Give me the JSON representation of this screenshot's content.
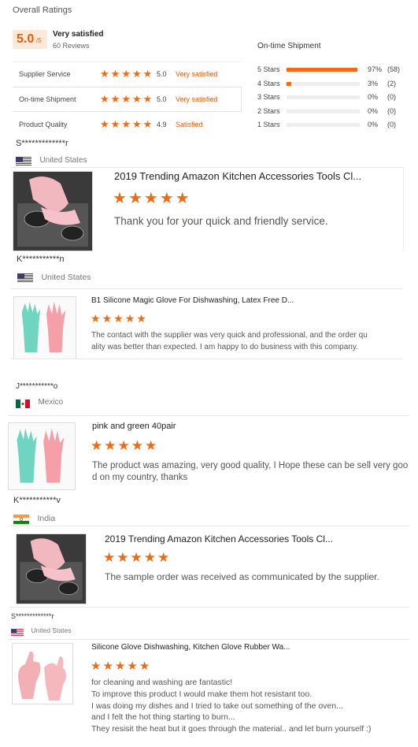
{
  "overall": {
    "heading": "Overall Ratings",
    "score": "5.0",
    "score_suffix": "/5",
    "label": "Very satisfied",
    "reviews": "60 Reviews"
  },
  "metrics": [
    {
      "label": "Supplier Service",
      "score": "5.0",
      "text": "Very satisfied",
      "stars": 5
    },
    {
      "label": "On-time Shipment",
      "score": "5.0",
      "text": "Very satisfied",
      "stars": 5
    },
    {
      "label": "Product Quality",
      "score": "4.9",
      "text": "Satisfied",
      "stars": 5
    }
  ],
  "shipment": {
    "title": "On-time Shipment",
    "rows": [
      {
        "label": "5 Stars",
        "percent": "97%",
        "count": "(58)",
        "fraction": 0.97
      },
      {
        "label": "4 Stars",
        "percent": "3%",
        "count": "(2)",
        "fraction": 0.06
      },
      {
        "label": "3 Stars",
        "percent": "0%",
        "count": "(0)",
        "fraction": 0
      },
      {
        "label": "2 Stars",
        "percent": "0%",
        "count": "(0)",
        "fraction": 0
      },
      {
        "label": "1 Stars",
        "percent": "0%",
        "count": "(0)",
        "fraction": 0
      }
    ]
  },
  "reviews": [
    {
      "name": "S*************r",
      "country": "United States",
      "product": "2019 Trending Amazon Kitchen Accessories Tools Cl...",
      "comment": [
        "Thank you for your quick and friendly service."
      ],
      "stars": 5
    },
    {
      "name": "K***********n",
      "country": "United States",
      "product": "B1 Silicone Magic Glove For Dishwashing, Latex Free D...",
      "comment": [
        "The contact with the supplier was very quick and professional, and the order qu",
        "ality was better than expected.  I am happy to do business with this company."
      ],
      "stars": 5
    },
    {
      "name": "J***********o",
      "country": "Mexico",
      "product": "pink and green 40pair",
      "comment": [
        "The product was amazing, very good quality, I Hope these can be sell very goo",
        "d on my country, thanks"
      ],
      "stars": 5
    },
    {
      "name": "K***********v",
      "country": "India",
      "product": "2019 Trending Amazon Kitchen Accessories Tools Cl...",
      "comment": [
        "The sample order was received as communicated by the supplier."
      ],
      "stars": 5
    },
    {
      "name": "S*************r",
      "country": "United States",
      "product": "Silicone Glove Dishwashing, Kitchen Glove Rubber Wa...",
      "comment": [
        "for cleaning and washing are fantastic!",
        "To improve this product I would make them hot resistant too.",
        "I was doing my dishes and I tried to take out something of the oven...",
        "and I felt  the hot thing starting to burn...",
        "They resisit the heat but it goes through the material.. and let burn yourself :)"
      ],
      "stars": 5
    }
  ],
  "colors": {
    "accent": "#f26a10",
    "accent_bg": "#fde9d9",
    "bar_track": "#eeeeee"
  }
}
